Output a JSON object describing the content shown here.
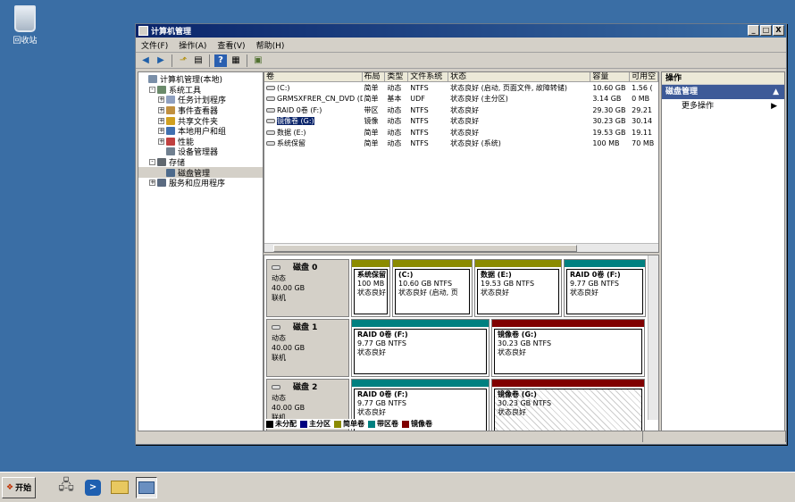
{
  "desktop": {
    "recycle_bin_label": "回收站"
  },
  "window": {
    "title": "计算机管理",
    "controls": {
      "minimize": "_",
      "maximize": "□",
      "close": "X"
    }
  },
  "menu": [
    "文件(F)",
    "操作(A)",
    "查看(V)",
    "帮助(H)"
  ],
  "tree": [
    {
      "label": "计算机管理(本地)",
      "level": 0,
      "exp": ""
    },
    {
      "label": "系统工具",
      "level": 1,
      "exp": "-"
    },
    {
      "label": "任务计划程序",
      "level": 2,
      "exp": "+"
    },
    {
      "label": "事件查看器",
      "level": 2,
      "exp": "+"
    },
    {
      "label": "共享文件夹",
      "level": 2,
      "exp": "+"
    },
    {
      "label": "本地用户和组",
      "level": 2,
      "exp": "+"
    },
    {
      "label": "性能",
      "level": 2,
      "exp": "+"
    },
    {
      "label": "设备管理器",
      "level": 2,
      "exp": ""
    },
    {
      "label": "存储",
      "level": 1,
      "exp": "-"
    },
    {
      "label": "磁盘管理",
      "level": 2,
      "exp": "",
      "selected": true
    },
    {
      "label": "服务和应用程序",
      "level": 1,
      "exp": "+"
    }
  ],
  "list": {
    "headers": [
      "卷",
      "布局",
      "类型",
      "文件系统",
      "状态",
      "容量",
      "可用空"
    ],
    "rows": [
      [
        "(C:)",
        "简单",
        "动态",
        "NTFS",
        "状态良好 (启动, 页面文件, 故障转储)",
        "10.60 GB",
        "1.56 ("
      ],
      [
        "GRMSXFRER_CN_DVD (D:)",
        "简单",
        "基本",
        "UDF",
        "状态良好 (主分区)",
        "3.14 GB",
        "0 MB"
      ],
      [
        "RAID 0卷 (F:)",
        "带区",
        "动态",
        "NTFS",
        "状态良好",
        "29.30 GB",
        "29.21"
      ],
      [
        "镜像卷 (G:)",
        "镜像",
        "动态",
        "NTFS",
        "状态良好",
        "30.23 GB",
        "30.14"
      ],
      [
        "数据 (E:)",
        "简单",
        "动态",
        "NTFS",
        "状态良好",
        "19.53 GB",
        "19.11"
      ],
      [
        "系统保留",
        "简单",
        "动态",
        "NTFS",
        "状态良好 (系统)",
        "100 MB",
        "70 MB"
      ]
    ]
  },
  "disks": [
    {
      "name": "磁盘 0",
      "type": "动态",
      "size": "40.00 GB",
      "status": "联机",
      "volumes": [
        {
          "title": "系统保留",
          "line2": "100 MB N",
          "line3": "状态良好",
          "color": "#8b8b00"
        },
        {
          "title": "(C:)",
          "line2": "10.60 GB NTFS",
          "line3": "状态良好 (启动, 页",
          "color": "#8b8b00"
        },
        {
          "title": "数据  (E:)",
          "line2": "19.53 GB NTFS",
          "line3": "状态良好",
          "color": "#8b8b00"
        },
        {
          "title": "RAID 0卷  (F:)",
          "line2": "9.77 GB NTFS",
          "line3": "状态良好",
          "color": "#008080"
        }
      ]
    },
    {
      "name": "磁盘 1",
      "type": "动态",
      "size": "40.00 GB",
      "status": "联机",
      "volumes": [
        {
          "title": "RAID 0卷  (F:)",
          "line2": "9.77 GB NTFS",
          "line3": "状态良好",
          "color": "#008080"
        },
        {
          "title": "镜像卷  (G:)",
          "line2": "30.23 GB NTFS",
          "line3": "状态良好",
          "color": "#800000"
        }
      ]
    },
    {
      "name": "磁盘 2",
      "type": "动态",
      "size": "40.00 GB",
      "status": "联机",
      "volumes": [
        {
          "title": "RAID 0卷  (F:)",
          "line2": "9.77 GB NTFS",
          "line3": "状态良好",
          "color": "#008080"
        },
        {
          "title": "镜像卷  (G:)",
          "line2": "30.23 GB NTFS",
          "line3": "状态良好",
          "color": "#800000"
        }
      ]
    }
  ],
  "legend": [
    {
      "label": "未分配",
      "color": "#000000"
    },
    {
      "label": "主分区",
      "color": "#000080"
    },
    {
      "label": "简单卷",
      "color": "#8b8b00"
    },
    {
      "label": "带区卷",
      "color": "#008080"
    },
    {
      "label": "镜像卷",
      "color": "#800000"
    }
  ],
  "actions": {
    "header": "操作",
    "section": "磁盘管理",
    "item": "更多操作"
  },
  "taskbar": {
    "start_label": "开始"
  }
}
